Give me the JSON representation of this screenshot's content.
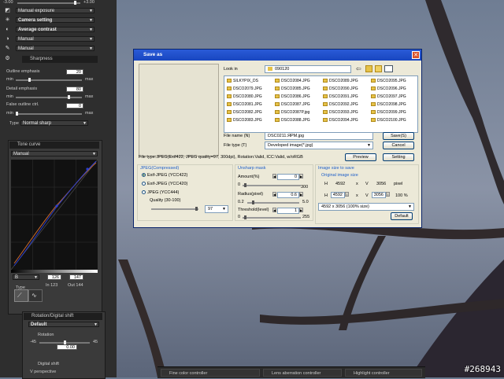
{
  "left_panel": {
    "exposure_min": "-3.00",
    "exposure_max": "+3.00",
    "exposure_mode": "Manual exposure",
    "camera_setting": "Camera setting",
    "metering": "Average contrast",
    "sel4": "Manual",
    "sel5": "Manual",
    "sharpness_title": "Sharpness",
    "outline_emphasis_label": "Outline emphasis",
    "outline_emphasis_value": "20",
    "detail_emphasis_label": "Detail emphasis",
    "detail_emphasis_value": "80",
    "false_outline_label": "False outline ctrl.",
    "false_outline_value": "0",
    "min": "min",
    "max": "max",
    "type_label": "Type",
    "type_value": "Normal sharp",
    "tone_curve_title": "Tone curve",
    "tone_curve_mode": "Manual",
    "channel": "B",
    "in_value": "126",
    "out_value": "147",
    "in_readout": "In 123",
    "out_readout": "Out 144",
    "type_group_label": "Type",
    "rotation_title": "Rotation/Digital shift",
    "rotation_default": "Default",
    "rotation_label": "Rotation",
    "rotation_min": "-45",
    "rotation_max": "45",
    "rotation_value": "0.00",
    "digital_shift_label": "Digital shift",
    "v_perspective_label": "V perspective"
  },
  "dialog": {
    "title": "Save as",
    "look_in_label": "Look in",
    "look_in_value": "090120",
    "files": [
      "SILKYPIX_DS",
      "DSCO2084.JPG",
      "DSCO2089.JPG",
      "DSCO2095.JPG",
      "DSCO2079.JPG",
      "DSCO2085.JPG",
      "DSCO2090.JPG",
      "DSCO2096.JPG",
      "DSCO2080.JPG",
      "DSCO2086.JPG",
      "DSCO2091.JPG",
      "DSCO2097.JPG",
      "DSCO2081.JPG",
      "DSCO2087.JPG",
      "DSCO2092.JPG",
      "DSCO2098.JPG",
      "DSCO2082.JPG",
      "DSCO2087P.jpg",
      "DSCO2093.JPG",
      "DSCO2099.JPG",
      "DSCO2083.JPG",
      "DSCO2088.JPG",
      "DSCO2094.JPG",
      "DSCO2100.JPG"
    ],
    "file_name_label": "File name",
    "file_name_shortcut": "(N)",
    "file_name_value": "DSC0211.ЯPM.jpg",
    "file_type_label": "File type",
    "file_type_shortcut": "(T)",
    "file_type_value": "Developed image(*.jpg)",
    "save_button": "Save(S)",
    "cancel_button": "Cancel",
    "preview_button": "Preview",
    "setting_button": "Setting",
    "info_line": "File type:JPEG(Exif422, JPEG quality=97, 300dpi), Rotation:Valid, ICC:Valid, w/oRGB",
    "jpeg_group": "JPEG(Compressed)",
    "jpeg_opt1": "Exif-JPEG (YCC422)",
    "jpeg_opt2": "Exif-JPEG (YCC420)",
    "jpeg_opt3": "JPEG (YCC444)",
    "quality_label": "Quality (30-100)",
    "quality_value": "97",
    "unsharp_group": "Unsharp mask",
    "amount_label": "Amount(%)",
    "amount_value": "0",
    "amount_min": "0",
    "amount_max": "300",
    "radius_label": "Radius(pixel)",
    "radius_value": "0.6",
    "radius_min": "0.2",
    "radius_max": "5.0",
    "threshold_label": "Threshold(level)",
    "threshold_value": "1",
    "threshold_min": "0",
    "threshold_max": "255",
    "size_group": "Image size to save",
    "orig_size_label": "Original image size",
    "orig_h_label": "H",
    "orig_h": "4592",
    "orig_x": "x",
    "orig_v_label": "V",
    "orig_v": "3056",
    "pixel_label": "pixel",
    "new_h_label": "H",
    "new_h": "4592",
    "new_x": "x",
    "new_v_label": "V",
    "new_v": "3056",
    "percent": "100 %",
    "size_preset": "4592 x 3056 (100% size)",
    "default_button": "Default"
  },
  "bottom_bar": {
    "item1": "Fine color controller",
    "item2": "Lens aberration controller",
    "item3": "Highlight controller"
  },
  "watermark": "#268943"
}
